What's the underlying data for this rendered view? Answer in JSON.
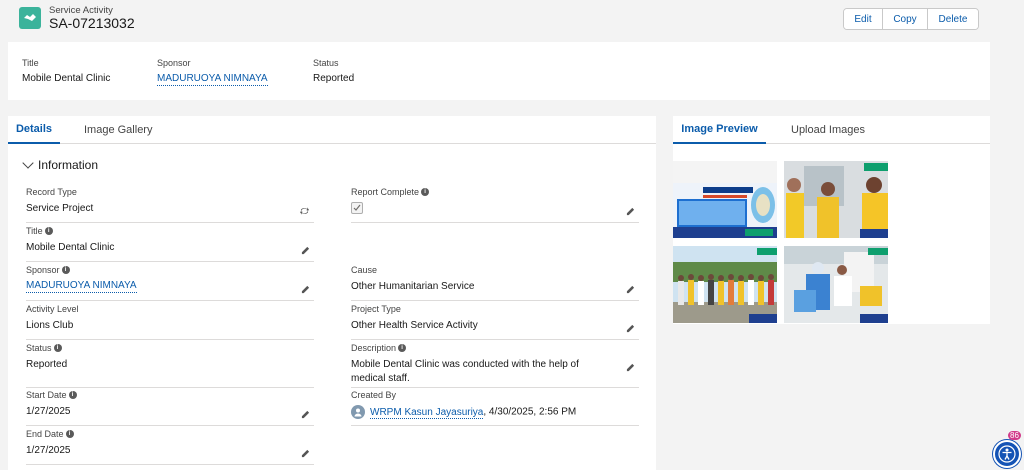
{
  "header": {
    "object_label": "Service Activity",
    "record_name": "SA-07213032",
    "buttons": {
      "edit": "Edit",
      "copy": "Copy",
      "delete": "Delete"
    },
    "icon": "handshake-icon"
  },
  "highlights": {
    "title_label": "Title",
    "title_value": "Mobile Dental Clinic",
    "sponsor_label": "Sponsor",
    "sponsor_value": "MADURUOYA NIMNAYA",
    "status_label": "Status",
    "status_value": "Reported"
  },
  "left_tabs": [
    "Details",
    "Image Gallery"
  ],
  "section_title": "Information",
  "fields": {
    "record_type_label": "Record Type",
    "record_type_value": "Service Project",
    "title_label": "Title",
    "title_value": "Mobile Dental Clinic",
    "sponsor_label": "Sponsor",
    "sponsor_value": "MADURUOYA NIMNAYA",
    "activity_level_label": "Activity Level",
    "activity_level_value": "Lions Club",
    "status_label": "Status",
    "status_value": "Reported",
    "start_date_label": "Start Date",
    "start_date_value": "1/27/2025",
    "end_date_label": "End Date",
    "end_date_value": "1/27/2025",
    "report_complete_label": "Report Complete",
    "report_complete_checked": true,
    "cause_label": "Cause",
    "cause_value": "Other Humanitarian Service",
    "project_type_label": "Project Type",
    "project_type_value": "Other Health Service Activity",
    "description_label": "Description",
    "description_value": "Mobile Dental Clinic was conducted with the help of medical staff.",
    "created_by_label": "Created By",
    "created_by_user": "WRPM Kasun Jayasuriya",
    "created_by_date": ", 4/30/2025, 2:56 PM"
  },
  "right_tabs": [
    "Image Preview",
    "Upload Images"
  ],
  "colors": {
    "brand": "#0b5cab",
    "icon_bg": "#3bb39b",
    "background": "#f3f3f3"
  },
  "accessibility_badge": "86"
}
